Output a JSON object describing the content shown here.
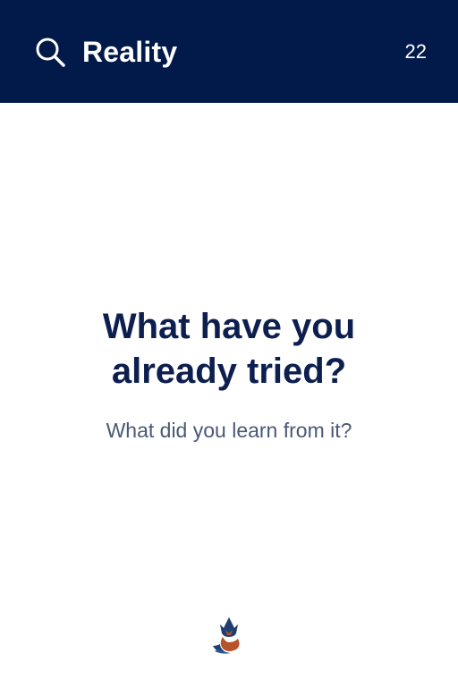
{
  "header": {
    "category": "Reality",
    "card_number": "22",
    "search_icon": "search-icon",
    "background_color": "#011a4a"
  },
  "card": {
    "question": "What have you already tried?",
    "prompt": "What did you learn from it?"
  },
  "footer": {
    "logo_icon": "fox-logo-icon"
  },
  "colors": {
    "question": "#0d1f4f",
    "prompt": "#4a5877",
    "logo_blue": "#1f3f73",
    "logo_rust": "#b5532a"
  }
}
